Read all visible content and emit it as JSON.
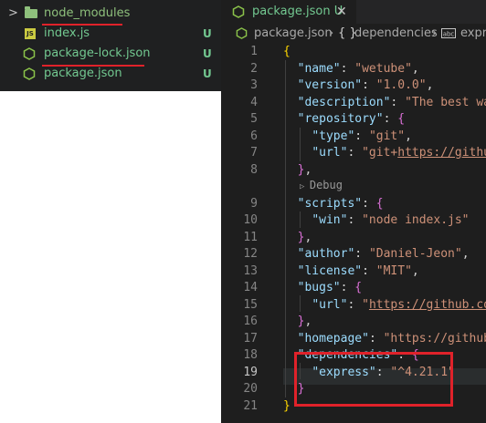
{
  "explorer": {
    "items": [
      {
        "name": "node_modules",
        "badge": "",
        "type": "folder"
      },
      {
        "name": "index.js",
        "badge": "U",
        "type": "js"
      },
      {
        "name": "package-lock.json",
        "badge": "U",
        "type": "npm"
      },
      {
        "name": "package.json",
        "badge": "U",
        "type": "npm"
      }
    ]
  },
  "tab": {
    "label": "package.json",
    "status": "U",
    "close": "✕"
  },
  "breadcrumb": {
    "file": "package.json",
    "sep1": "›",
    "node_icon": "{ }",
    "node": "dependencies",
    "sep2": "›",
    "last": "expre"
  },
  "codelens": "Debug",
  "lines": [
    "1",
    "2",
    "3",
    "4",
    "5",
    "6",
    "7",
    "8",
    "9",
    "10",
    "11",
    "12",
    "13",
    "14",
    "15",
    "16",
    "17",
    "18",
    "19",
    "20",
    "21"
  ],
  "code": {
    "l1": "{",
    "name_k": "\"name\"",
    "name_v": "\"wetube\"",
    "version_k": "\"version\"",
    "version_v": "\"1.0.0\"",
    "desc_k": "\"description\"",
    "desc_v": "\"The best wa",
    "repo_k": "\"repository\"",
    "type_k": "\"type\"",
    "type_v": "\"git\"",
    "url_k": "\"url\"",
    "url_v1": "\"git+",
    "url_v2": "https://githu",
    "close_obj": "},",
    "scripts_k": "\"scripts\"",
    "win_k": "\"win\"",
    "win_v": "\"node index.js\"",
    "author_k": "\"author\"",
    "author_v": "\"Daniel-Jeon\"",
    "license_k": "\"license\"",
    "license_v": "\"MIT\"",
    "bugs_k": "\"bugs\"",
    "bugs_url_k": "\"url\"",
    "bugs_url_v1": "\"",
    "bugs_url_v2": "https://github.co",
    "homepage_k": "\"homepage\"",
    "homepage_v": "\"https://github",
    "deps_k": "\"dependencies\"",
    "express_k": "\"express\"",
    "express_v": "\"^4.21.1\"",
    "close_brace": "}",
    "last": "}"
  }
}
